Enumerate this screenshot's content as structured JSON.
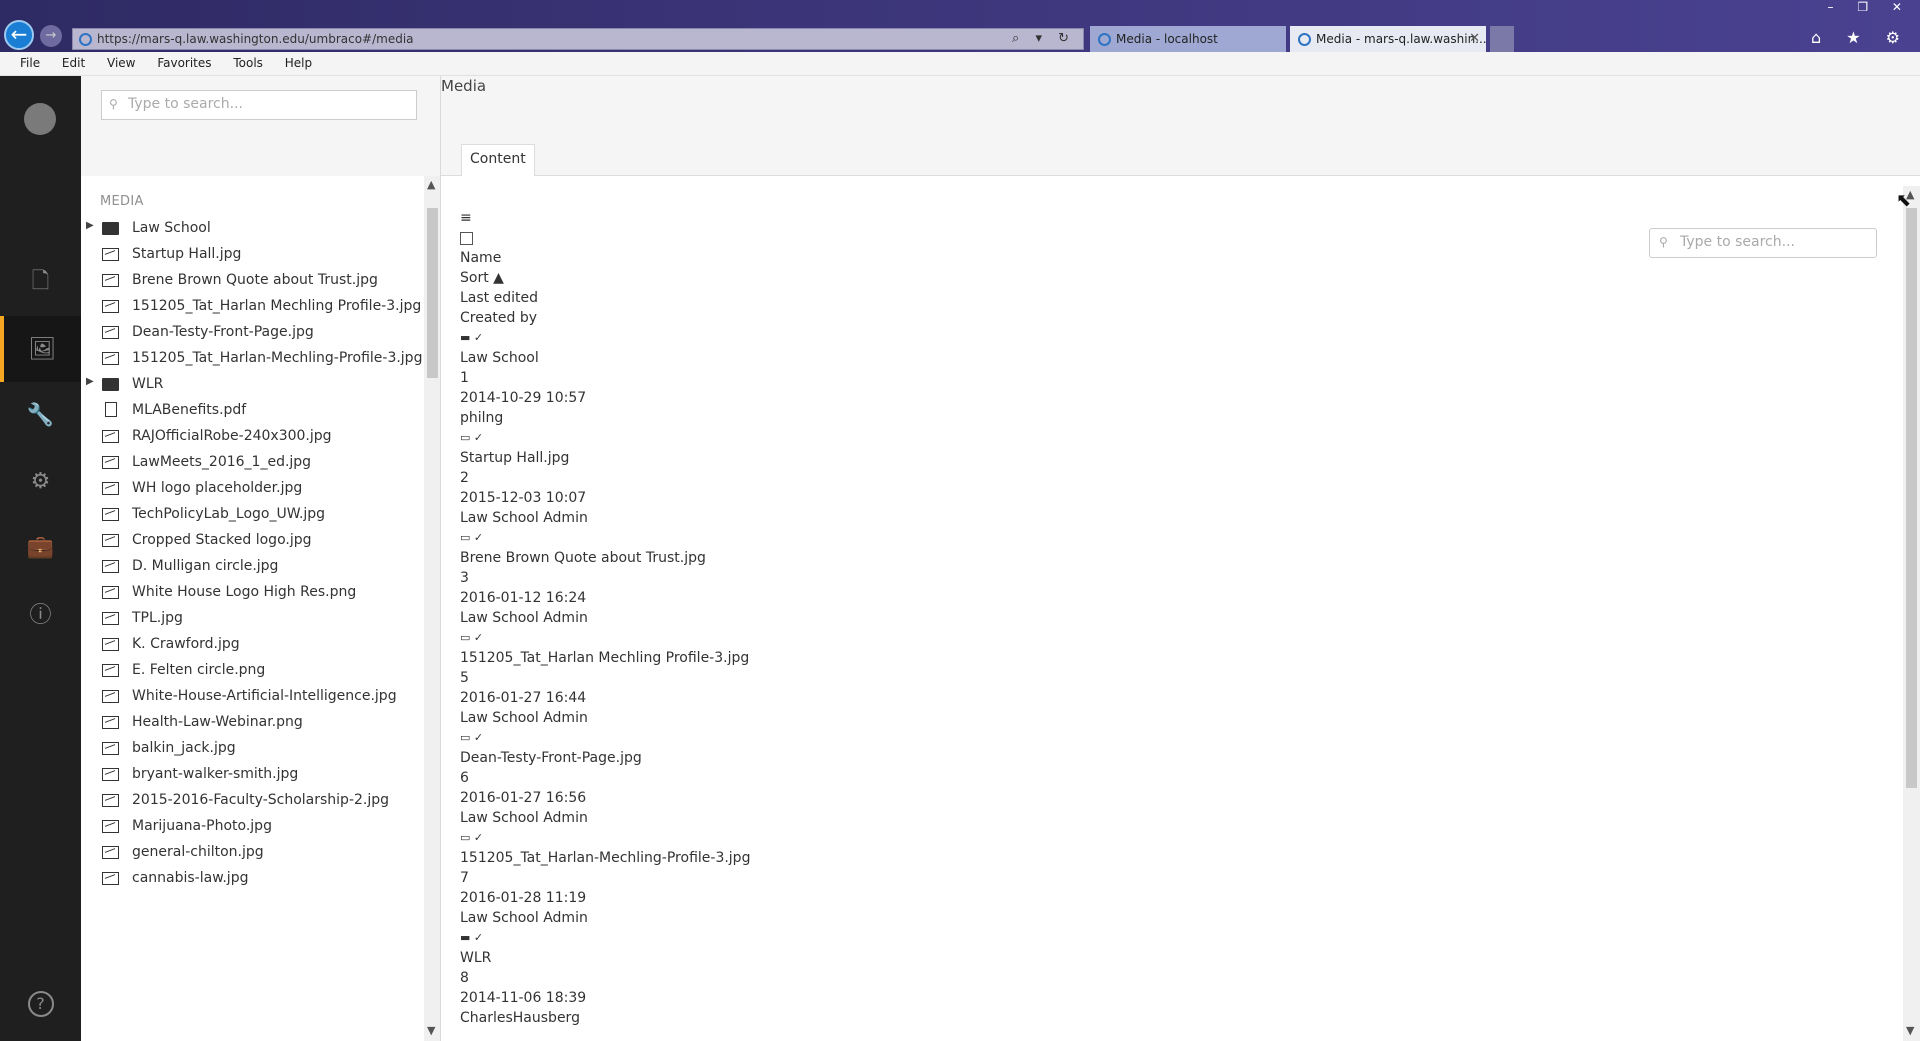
{
  "browser": {
    "url": "https://mars-q.law.washington.edu/umbraco#/media",
    "address_tools": "⌕ ▾ ↻",
    "tabs": [
      {
        "label": "Media - localhost"
      },
      {
        "label": "Media - mars-q.law.washin..."
      }
    ],
    "window_controls": "– ❐ ✕",
    "right_icons": "⌂ ★ ⚙"
  },
  "menubar": [
    "File",
    "Edit",
    "View",
    "Favorites",
    "Tools",
    "Help"
  ],
  "appbar": {
    "items": [
      {
        "icon": "content-document-icon",
        "glyph": "🗋"
      },
      {
        "icon": "media-image-icon",
        "glyph": "🖼",
        "active": true
      },
      {
        "icon": "wrench-icon",
        "glyph": "🔧"
      },
      {
        "icon": "gear-icon",
        "glyph": "⚙"
      },
      {
        "icon": "briefcase-icon",
        "glyph": "💼"
      },
      {
        "icon": "members-icon",
        "glyph": "ⓘ"
      }
    ],
    "help_glyph": "?"
  },
  "tree": {
    "search_placeholder": "Type to search...",
    "section_title": "MEDIA",
    "items": [
      {
        "label": "Law School",
        "type": "folder",
        "expandable": true
      },
      {
        "label": "Startup Hall.jpg",
        "type": "image"
      },
      {
        "label": "Brene Brown Quote about Trust.jpg",
        "type": "image"
      },
      {
        "label": "151205_Tat_Harlan Mechling Profile-3.jpg",
        "type": "image"
      },
      {
        "label": "Dean-Testy-Front-Page.jpg",
        "type": "image"
      },
      {
        "label": "151205_Tat_Harlan-Mechling-Profile-3.jpg",
        "type": "image"
      },
      {
        "label": "WLR",
        "type": "folder",
        "expandable": true
      },
      {
        "label": "MLABenefits.pdf",
        "type": "file"
      },
      {
        "label": "RAJOfficialRobe-240x300.jpg",
        "type": "image"
      },
      {
        "label": "LawMeets_2016_1_ed.jpg",
        "type": "image"
      },
      {
        "label": "WH logo placeholder.jpg",
        "type": "image"
      },
      {
        "label": "TechPolicyLab_Logo_UW.jpg",
        "type": "image"
      },
      {
        "label": "Cropped Stacked logo.jpg",
        "type": "image"
      },
      {
        "label": "D. Mulligan circle.jpg",
        "type": "image"
      },
      {
        "label": "White House Logo High Res.png",
        "type": "image"
      },
      {
        "label": "TPL.jpg",
        "type": "image"
      },
      {
        "label": "K. Crawford.jpg",
        "type": "image"
      },
      {
        "label": "E. Felten circle.png",
        "type": "image"
      },
      {
        "label": "White-House-Artificial-Intelligence.jpg",
        "type": "image"
      },
      {
        "label": "Health-Law-Webinar.png",
        "type": "image"
      },
      {
        "label": "balkin_jack.jpg",
        "type": "image"
      },
      {
        "label": "bryant-walker-smith.jpg",
        "type": "image"
      },
      {
        "label": "2015-2016-Faculty-Scholarship-2.jpg",
        "type": "image"
      },
      {
        "label": "Marijuana-Photo.jpg",
        "type": "image"
      },
      {
        "label": "general-chilton.jpg",
        "type": "image"
      },
      {
        "label": "cannabis-law.jpg",
        "type": "image"
      }
    ]
  },
  "main": {
    "title": "Media",
    "tab": "Content",
    "search_placeholder": "Type to search...",
    "list_header": {
      "menu_glyph": "≡",
      "name": "Name",
      "sort": "Sort ▲",
      "last_edited": "Last edited",
      "created_by": "Created by"
    },
    "rows": [
      {
        "marker": "▬ ✓",
        "name": "Law School",
        "sort": "1",
        "edited": "2014-10-29 10:57",
        "creator": "philng"
      },
      {
        "marker": "▭ ✓",
        "name": "Startup Hall.jpg",
        "sort": "2",
        "edited": "2015-12-03 10:07",
        "creator": "Law School Admin"
      },
      {
        "marker": "▭ ✓",
        "name": "Brene Brown Quote about Trust.jpg",
        "sort": "3",
        "edited": "2016-01-12 16:24",
        "creator": "Law School Admin"
      },
      {
        "marker": "▭ ✓",
        "name": "151205_Tat_Harlan Mechling Profile-3.jpg",
        "sort": "5",
        "edited": "2016-01-27 16:44",
        "creator": "Law School Admin"
      },
      {
        "marker": "▭ ✓",
        "name": "Dean-Testy-Front-Page.jpg",
        "sort": "6",
        "edited": "2016-01-27 16:56",
        "creator": "Law School Admin"
      },
      {
        "marker": "▭ ✓",
        "name": "151205_Tat_Harlan-Mechling-Profile-3.jpg",
        "sort": "7",
        "edited": "2016-01-28 11:19",
        "creator": "Law School Admin"
      },
      {
        "marker": "▬ ✓",
        "name": "WLR",
        "sort": "8",
        "edited": "2014-11-06 18:39",
        "creator": "CharlesHausberg"
      }
    ]
  }
}
